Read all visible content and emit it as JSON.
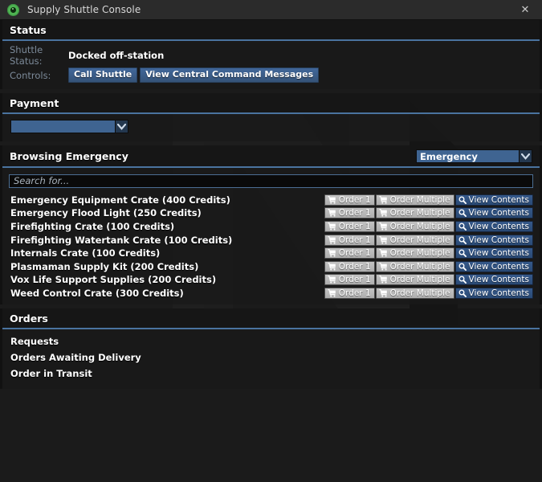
{
  "window": {
    "title": "Supply Shuttle Console",
    "app_icon": "eye-icon",
    "close_label": "✕"
  },
  "theme": {
    "accent_blue": "#4a739f",
    "button_blue": "#3a5d8a",
    "dropdown_blue": "#3f6491",
    "panel_bg": "#1a1a1a",
    "titlebar_bg": "#2b2b2b",
    "icon_green": "#4eb352",
    "label_gray": "#7c8a99",
    "text_white": "#ffffff"
  },
  "status": {
    "section_title": "Status",
    "shuttle_status_label": "Shuttle Status:",
    "shuttle_status_value": "Docked off-station",
    "controls_label": "Controls:",
    "buttons": [
      {
        "name": "call-shuttle-button",
        "label": "Call Shuttle"
      },
      {
        "name": "view-messages-button",
        "label": "View Central Command Messages"
      }
    ]
  },
  "payment": {
    "section_title": "Payment",
    "account_select": {
      "value": "",
      "placeholder": "",
      "options": []
    }
  },
  "browsing": {
    "section_title": "Browsing Emergency",
    "category_select": {
      "value": "Emergency",
      "options": [
        "Emergency"
      ]
    },
    "search": {
      "value": "",
      "placeholder": "Search for..."
    },
    "row_actions": {
      "order_one_label": "Order 1",
      "order_multiple_label": "Order Multiple",
      "view_contents_label": "View Contents",
      "cart_icon": "shopping-cart-icon",
      "search_icon": "magnifier-icon"
    },
    "items": [
      {
        "name": "Emergency Equipment Crate",
        "price": 400,
        "label": "Emergency Equipment Crate (400 Credits)"
      },
      {
        "name": "Emergency Flood Light",
        "price": 250,
        "label": "Emergency Flood Light (250 Credits)"
      },
      {
        "name": "Firefighting Crate",
        "price": 100,
        "label": "Firefighting Crate (100 Credits)"
      },
      {
        "name": "Firefighting Watertank Crate",
        "price": 100,
        "label": "Firefighting Watertank Crate (100 Credits)"
      },
      {
        "name": "Internals Crate",
        "price": 100,
        "label": "Internals Crate (100 Credits)"
      },
      {
        "name": "Plasmaman Supply Kit",
        "price": 200,
        "label": "Plasmaman Supply Kit (200 Credits)"
      },
      {
        "name": "Vox Life Support Supplies",
        "price": 200,
        "label": "Vox Life Support Supplies (200 Credits)"
      },
      {
        "name": "Weed Control Crate",
        "price": 300,
        "label": "Weed Control Crate (300 Credits)"
      }
    ]
  },
  "orders": {
    "section_title": "Orders",
    "lines": [
      {
        "label": "Requests"
      },
      {
        "label": "Orders Awaiting Delivery"
      },
      {
        "label": "Order in Transit"
      }
    ]
  }
}
